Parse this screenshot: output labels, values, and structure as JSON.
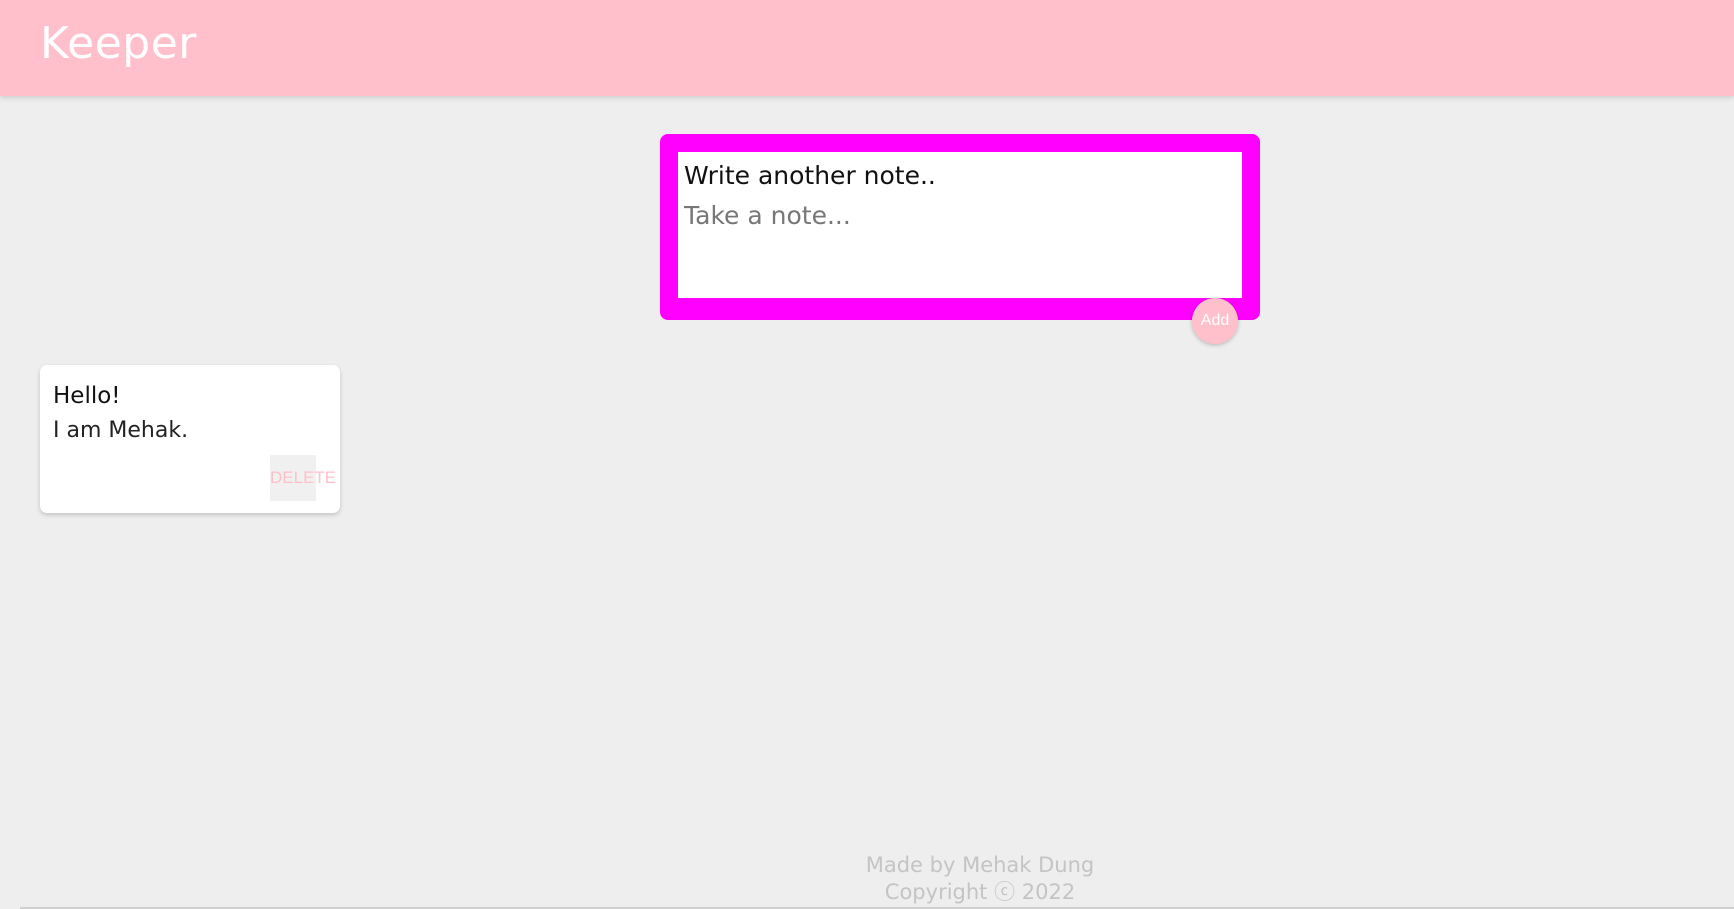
{
  "header": {
    "title": "Keeper"
  },
  "compose": {
    "title_value": "Write another note..",
    "content_placeholder": "Take a note...",
    "add_label": "Add"
  },
  "notes": [
    {
      "title": "Hello!",
      "content": "I am Mehak.",
      "delete_label": "DELETE"
    }
  ],
  "footer": {
    "line1": "Made by Mehak Dung",
    "line2": "Copyright ⓒ 2022"
  },
  "colors": {
    "header_bg": "#ffc0cb",
    "compose_border": "#ff00ff",
    "page_bg": "#eeeeee",
    "accent": "#ffc0cb"
  }
}
